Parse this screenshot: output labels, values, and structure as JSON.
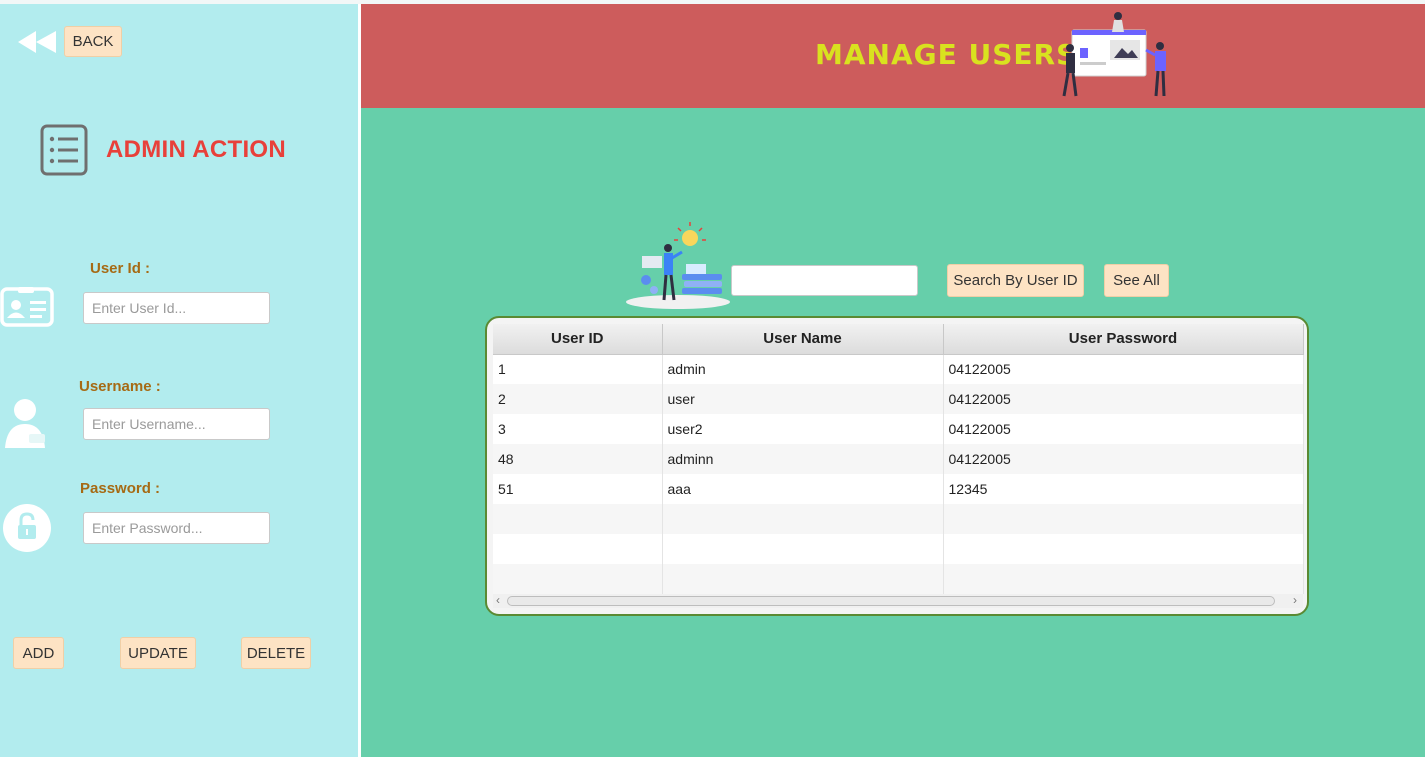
{
  "sidebar": {
    "back_label": "BACK",
    "section_title": "ADMIN ACTION",
    "user_id": {
      "label": "User Id :",
      "placeholder": "Enter User Id...",
      "value": ""
    },
    "username": {
      "label": "Username :",
      "placeholder": "Enter Username...",
      "value": ""
    },
    "password": {
      "label": "Password :",
      "placeholder": "Enter Password...",
      "value": ""
    },
    "buttons": {
      "add": "ADD",
      "update": "UPDATE",
      "delete": "DELETE"
    }
  },
  "header": {
    "title": "MANAGE USERS"
  },
  "search": {
    "value": "",
    "search_button": "Search By User ID",
    "see_all_button": "See All"
  },
  "table": {
    "columns": [
      "User ID",
      "User Name",
      "User Password"
    ],
    "rows": [
      [
        "1",
        "admin",
        "04122005"
      ],
      [
        "2",
        "user",
        "04122005"
      ],
      [
        "3",
        "user2",
        "04122005"
      ],
      [
        "48",
        "adminn",
        "04122005"
      ],
      [
        "51",
        "aaa",
        "12345"
      ]
    ]
  },
  "colors": {
    "sidebar_bg": "#b2ecee",
    "header_bg": "#cd5c5c",
    "main_bg": "#66cfaa",
    "button_bg": "#fde3c4",
    "title_red": "#e8403a",
    "label_brown": "#a66a14",
    "header_title": "#d9e21f"
  },
  "icons": [
    "rewind-icon",
    "list-icon",
    "id-card-icon",
    "user-icon",
    "lock-icon",
    "team-illustration",
    "search-illustration"
  ]
}
